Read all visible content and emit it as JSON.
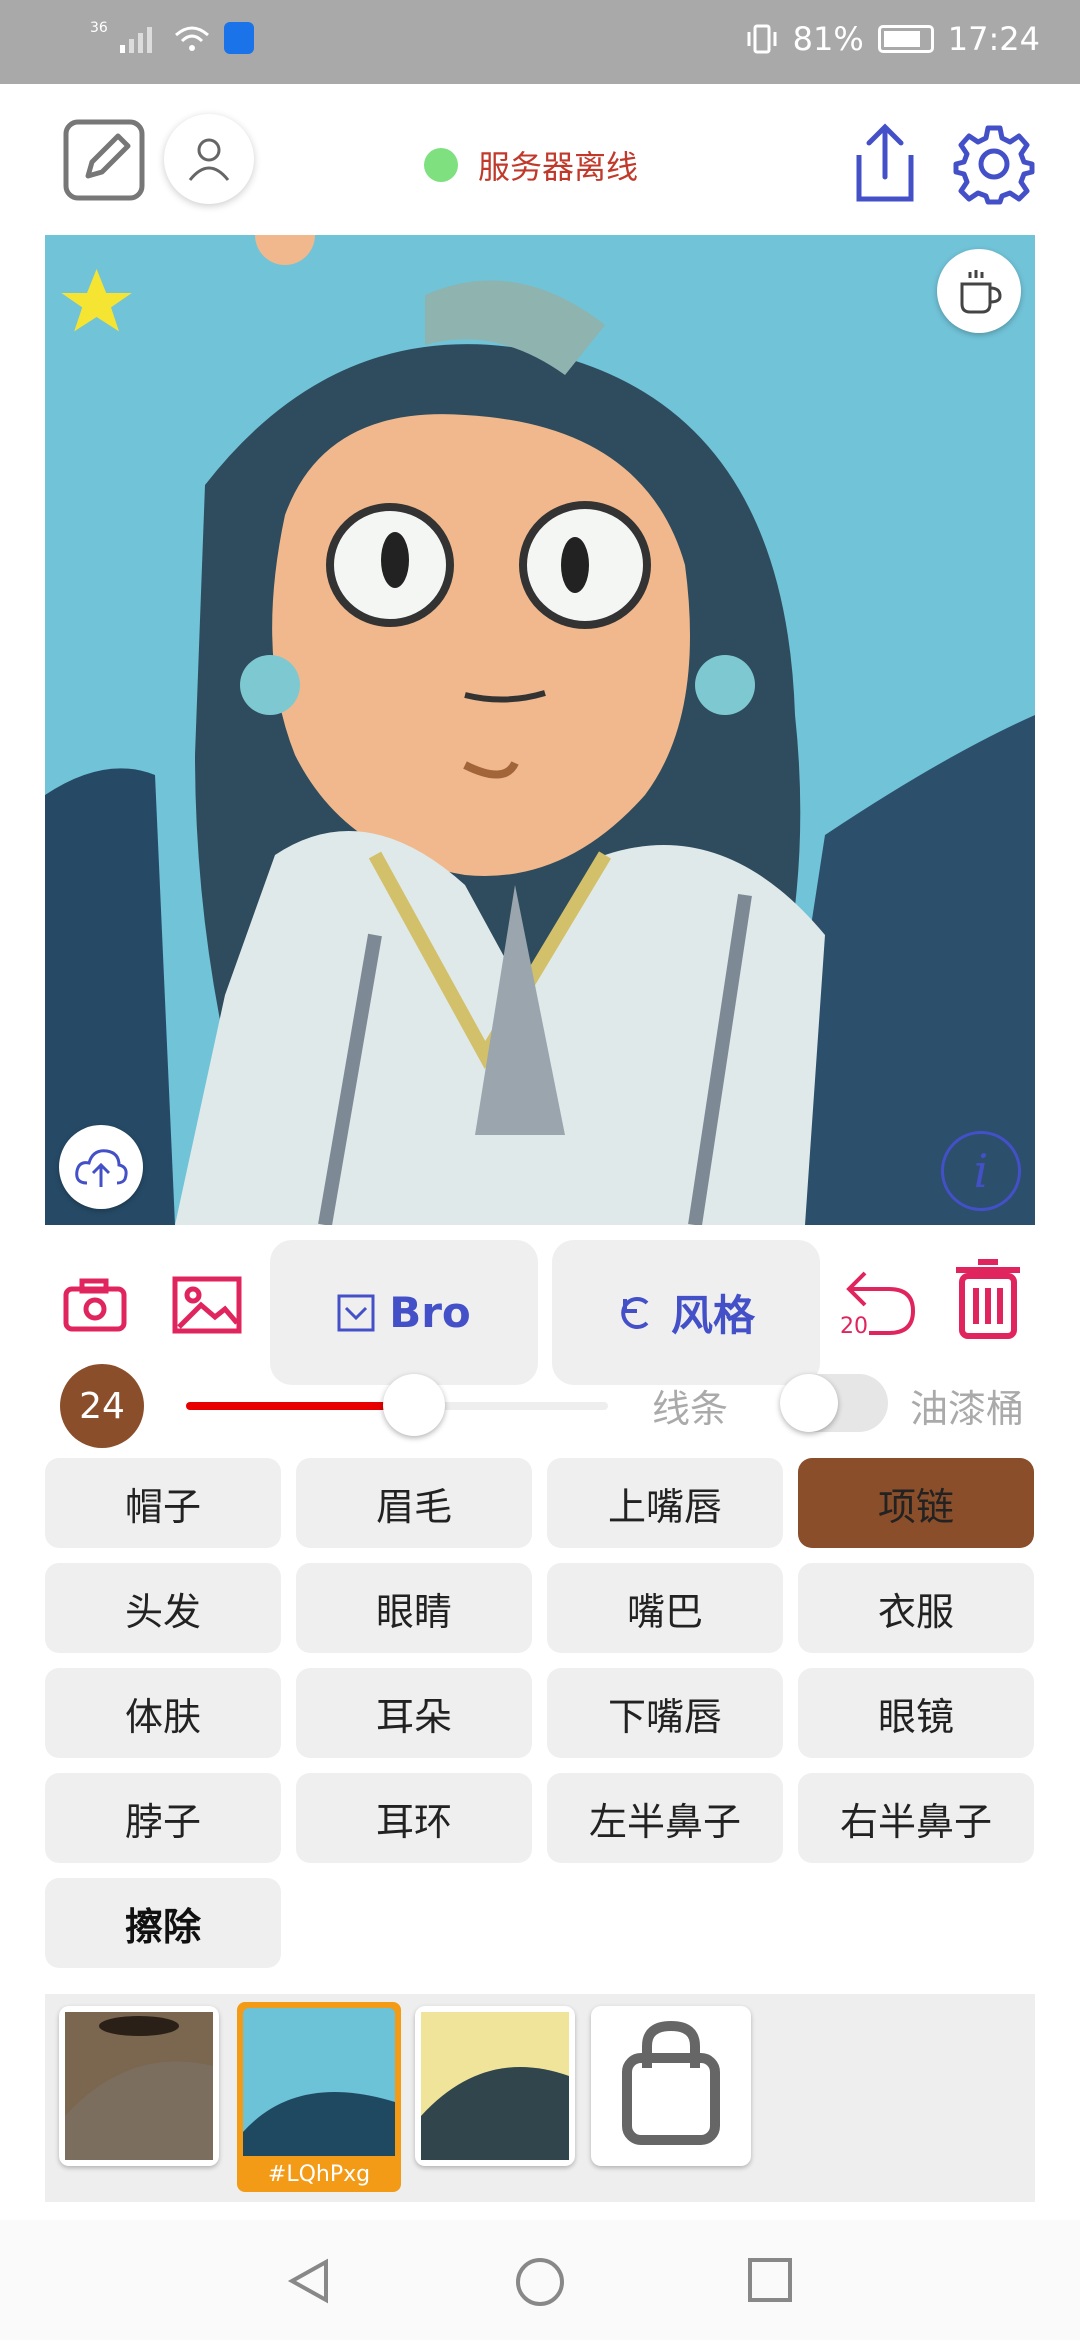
{
  "status_bar": {
    "network": "36",
    "battery": "81%",
    "time": "17:24"
  },
  "header": {
    "server_status": "服务器离线",
    "status_color": "#7ee07e"
  },
  "toolbar": {
    "font_button": "Bro",
    "style_button": "风格",
    "undo_count": "20"
  },
  "brush": {
    "size": "24",
    "slider_fraction": 0.54,
    "lines_label": "线条",
    "bucket_label": "油漆桶",
    "bucket_enabled": false
  },
  "parts": [
    {
      "label": "帽子",
      "active": false
    },
    {
      "label": "眉毛",
      "active": false
    },
    {
      "label": "上嘴唇",
      "active": false
    },
    {
      "label": "项链",
      "active": true
    },
    {
      "label": "头发",
      "active": false
    },
    {
      "label": "眼睛",
      "active": false
    },
    {
      "label": "嘴巴",
      "active": false
    },
    {
      "label": "衣服",
      "active": false
    },
    {
      "label": "体肤",
      "active": false
    },
    {
      "label": "耳朵",
      "active": false
    },
    {
      "label": "下嘴唇",
      "active": false
    },
    {
      "label": "眼镜",
      "active": false
    },
    {
      "label": "脖子",
      "active": false
    },
    {
      "label": "耳环",
      "active": false
    },
    {
      "label": "左半鼻子",
      "active": false
    },
    {
      "label": "右半鼻子",
      "active": false
    },
    {
      "label": "擦除",
      "active": false
    }
  ],
  "palette": {
    "selected_tag": "#LQhPxg"
  },
  "colors": {
    "accent_red": "#e0245e",
    "accent_blue": "#4450c8",
    "active_part": "#8b4e2a",
    "selected_swatch": "#f39a17"
  }
}
